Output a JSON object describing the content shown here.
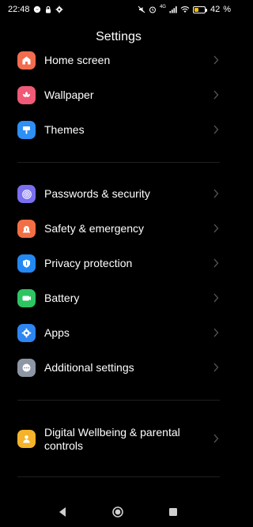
{
  "status_bar": {
    "time": "22:48",
    "network": "4G",
    "battery_percent": "42",
    "battery_level": 0.42,
    "icons": [
      "messenger-icon",
      "lock-icon",
      "settings-icon",
      "mute-icon",
      "alarm-icon",
      "signal-icon",
      "wifi-icon",
      "battery-icon"
    ]
  },
  "header": {
    "title": "Settings"
  },
  "groups": [
    {
      "items": [
        {
          "label": "Home screen",
          "icon": "home-icon",
          "color": "#f26c4f"
        },
        {
          "label": "Wallpaper",
          "icon": "flower-icon",
          "color": "#ef5a76"
        },
        {
          "label": "Themes",
          "icon": "brush-icon",
          "color": "#2e8ff5"
        }
      ]
    },
    {
      "items": [
        {
          "label": "Passwords & security",
          "icon": "fingerprint-icon",
          "color": "#7a6ff0"
        },
        {
          "label": "Safety & emergency",
          "icon": "siren-icon",
          "color": "#f26f45"
        },
        {
          "label": "Privacy protection",
          "icon": "shield-icon",
          "color": "#2388f3"
        },
        {
          "label": "Battery",
          "icon": "battery-icon",
          "color": "#2ec462"
        },
        {
          "label": "Apps",
          "icon": "gear-icon",
          "color": "#2d86f2"
        },
        {
          "label": "Additional settings",
          "icon": "more-icon",
          "color": "#8d96a5"
        }
      ]
    },
    {
      "items": [
        {
          "label": "Digital Wellbeing & parental controls",
          "icon": "person-icon",
          "color": "#f4b32a"
        }
      ]
    }
  ],
  "nav_bar": {
    "back": "back-icon",
    "home": "home-nav-icon",
    "recents": "recents-icon"
  }
}
